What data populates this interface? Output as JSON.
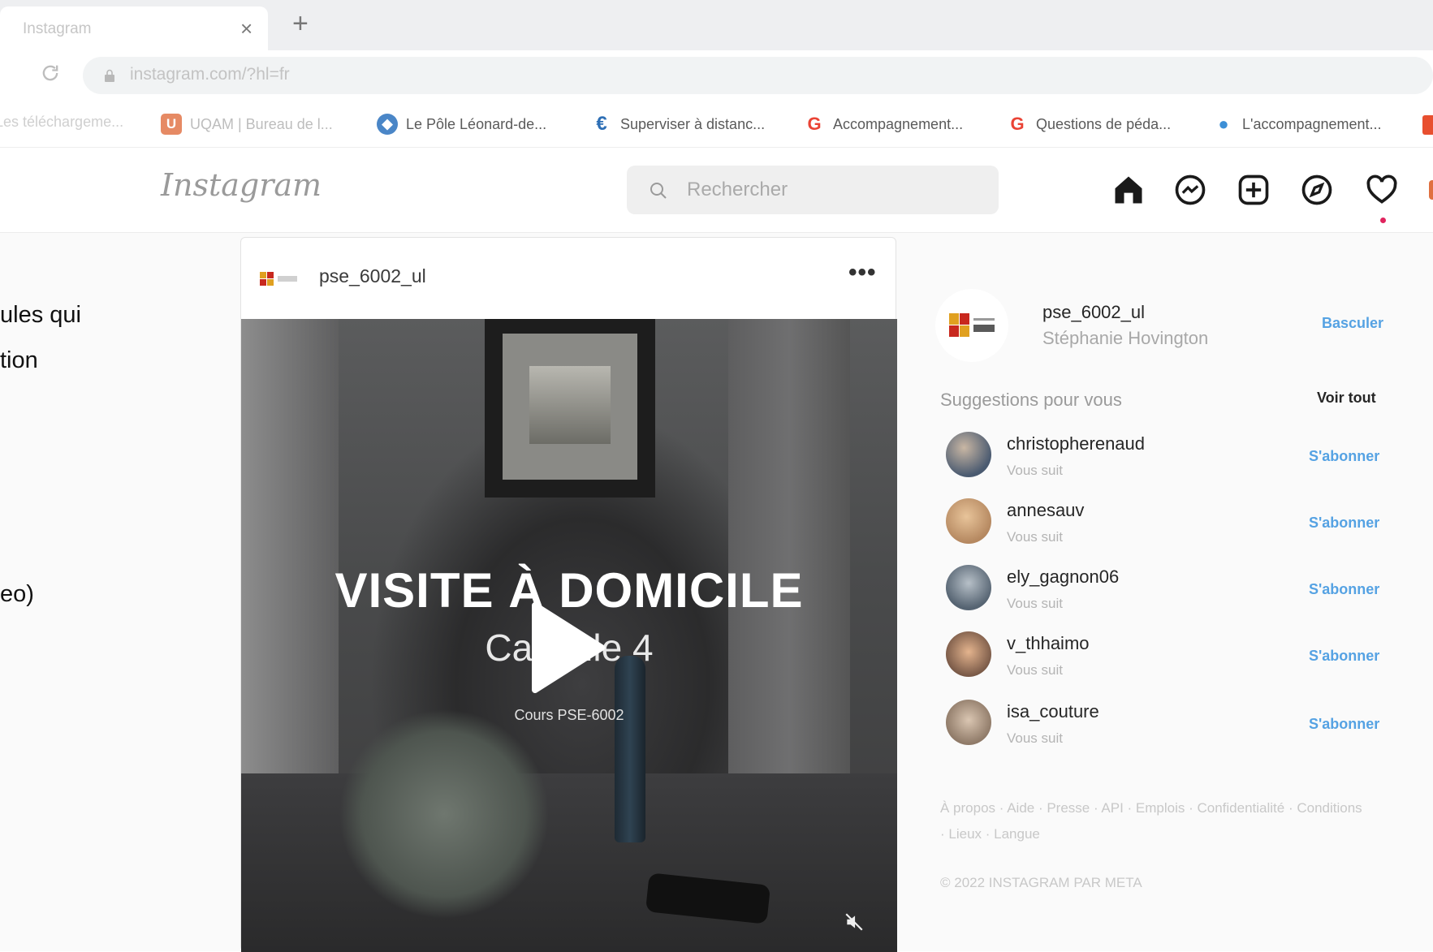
{
  "browser": {
    "tab_title": "Instagram",
    "url": "instagram.com/?hl=fr",
    "bookmarks": [
      {
        "label": "Les téléchargeme...",
        "icon": "download-icon",
        "color": "#cccccc"
      },
      {
        "label": "UQAM | Bureau de l...",
        "icon": "uqam-icon",
        "color": "#e68a64"
      },
      {
        "label": "Le Pôle Léonard-de...",
        "icon": "globe-icon",
        "color": "#4a86c7"
      },
      {
        "label": "Superviser à distanc...",
        "icon": "c-icon",
        "color": "#2e6fb5"
      },
      {
        "label": "Accompagnement...",
        "icon": "google-icon",
        "color": "#ea4335"
      },
      {
        "label": "Questions de péda...",
        "icon": "google-icon",
        "color": "#ea4335"
      },
      {
        "label": "L'accompagnement...",
        "icon": "profile-icon",
        "color": "#3c8fd6"
      }
    ]
  },
  "instagram": {
    "logo": "Instagram",
    "search_placeholder": "Rechercher",
    "nav_icons": [
      "home-icon",
      "messenger-icon",
      "new-post-icon",
      "explore-icon",
      "activity-heart-icon"
    ]
  },
  "side_text": {
    "line1": "ules qui",
    "line2": "tion",
    "line3": "eo)"
  },
  "post": {
    "username": "pse_6002_ul",
    "more": "•••",
    "video_title": "VISITE À DOMICILE",
    "video_subtitle": "Capsule 4",
    "video_course": "Cours PSE-6002"
  },
  "sidebar": {
    "username": "pse_6002_ul",
    "fullname": "Stéphanie Hovington",
    "switch_label": "Basculer",
    "suggestions_heading": "Suggestions pour vous",
    "see_all": "Voir tout",
    "suggestions": [
      {
        "name": "christopherenaud",
        "sub": "Vous suit",
        "action": "S'abonner",
        "color": "#4a5a70"
      },
      {
        "name": "annesauv",
        "sub": "Vous suit",
        "action": "S'abonner",
        "color": "#b58860"
      },
      {
        "name": "ely_gagnon06",
        "sub": "Vous suit",
        "action": "S'abonner",
        "color": "#566472"
      },
      {
        "name": "v_thhaimo",
        "sub": "Vous suit",
        "action": "S'abonner",
        "color": "#7a5a48"
      },
      {
        "name": "isa_couture",
        "sub": "Vous suit",
        "action": "S'abonner",
        "color": "#8f7a68"
      }
    ],
    "footer_links": "À propos · Aide · Presse · API · Emplois · Confidentialité · Conditions · Lieux · Langue",
    "copyright": "© 2022 INSTAGRAM PAR META"
  }
}
